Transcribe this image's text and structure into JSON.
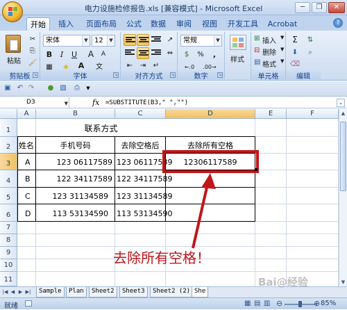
{
  "window": {
    "title": "电力设施检修报告.xls  [兼容模式] - Microsoft Excel",
    "minimize": "─",
    "restore": "❐",
    "close": "✕"
  },
  "ribbon_tabs": [
    {
      "label": "开始",
      "active": true
    },
    {
      "label": "插入"
    },
    {
      "label": "页面布局"
    },
    {
      "label": "公式"
    },
    {
      "label": "数据"
    },
    {
      "label": "审阅"
    },
    {
      "label": "视图"
    },
    {
      "label": "开发工具"
    },
    {
      "label": "Acrobat"
    }
  ],
  "help": "?",
  "ribbon": {
    "clipboard": {
      "label": "剪贴板",
      "paste": "粘贴"
    },
    "font": {
      "label": "字体",
      "name": "宋体",
      "size": "12",
      "bold": "B",
      "italic": "I",
      "underline": "U",
      "grow": "A",
      "shrink": "A",
      "font_color": "A",
      "wen": "文"
    },
    "alignment": {
      "label": "对齐方式"
    },
    "number": {
      "label": "数字",
      "format": "常规",
      "currency": "$",
      "percent": "%",
      "comma": ",",
      "inc": "←.0",
      "dec": ".00→"
    },
    "styles": {
      "label": "样式"
    },
    "cells": {
      "label": "单元格",
      "insert": "插入",
      "delete": "删除",
      "format": "格式"
    },
    "editing": {
      "label": "编辑",
      "sum": "Σ",
      "fill": "⬇",
      "clear": "⌫"
    }
  },
  "formula_bar": {
    "name_box": "D3",
    "fx": "fx",
    "formula": "=SUBSTITUTE(B3,\" \",\"\")"
  },
  "columns": [
    "A",
    "B",
    "C",
    "D",
    "E",
    "F"
  ],
  "rows": [
    "1",
    "2",
    "3",
    "4",
    "5",
    "6",
    "7",
    "8",
    "9",
    "10",
    "11"
  ],
  "table": {
    "title": "联系方式",
    "headers": [
      "姓名",
      "手机号码",
      "去除空格后",
      "去除所有空格"
    ],
    "data": [
      [
        "A",
        "123 06117589",
        "123 06117589",
        "12306117589"
      ],
      [
        "B",
        "122 34117589",
        "122 34117589",
        ""
      ],
      [
        "C",
        "123 31134589",
        "123 31134589",
        ""
      ],
      [
        "D",
        "113 53134590",
        "113 53134590",
        ""
      ]
    ]
  },
  "annotation": "去除所有空格！",
  "sheet_tabs": [
    "Sample",
    "Plan",
    "Sheet2",
    "Sheet3",
    "Sheet2 (2)",
    "She"
  ],
  "status": {
    "ready": "就绪",
    "zoom": "85%"
  },
  "watermark": "Bai@经验",
  "colors": {
    "accent": "#c0161a",
    "selected_header": "#f1c15f",
    "ribbon": "#cddcf0"
  }
}
